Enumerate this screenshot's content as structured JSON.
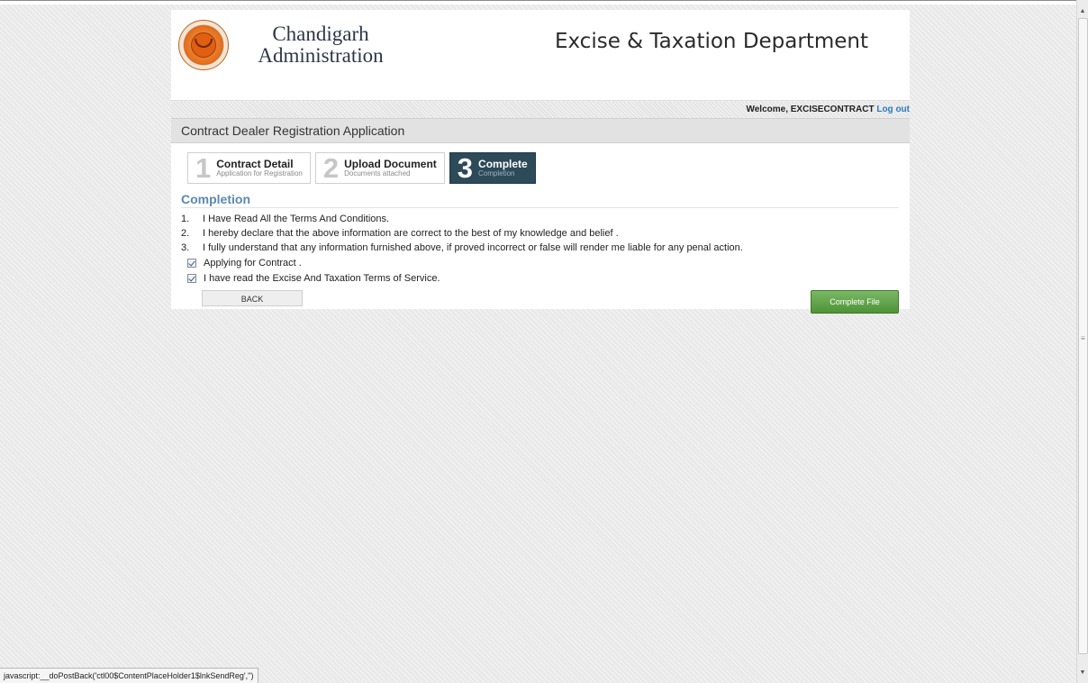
{
  "header": {
    "org_line1": "Chandigarh",
    "org_line2": "Administration",
    "department": "Excise & Taxation Department"
  },
  "welcome": {
    "prefix": "Welcome, ",
    "user": "EXCISECONTRACT",
    "logout": "Log out"
  },
  "page_title": "Contract Dealer Registration Application",
  "steps": [
    {
      "num": "1",
      "title": "Contract Detail",
      "subtitle": "Application for Registration",
      "active": false
    },
    {
      "num": "2",
      "title": "Upload Document",
      "subtitle": "Documents attached",
      "active": false
    },
    {
      "num": "3",
      "title": "Complete",
      "subtitle": "Completion",
      "active": true
    }
  ],
  "section_title": "Completion",
  "terms": [
    {
      "num": "1.",
      "text": "I Have Read All the Terms And Conditions."
    },
    {
      "num": "2.",
      "text": "I hereby declare that the above information are correct to the best of my knowledge and belief ."
    },
    {
      "num": "3.",
      "text": "I fully understand that any information furnished above, if proved incorrect or false will render me liable for any penal action."
    }
  ],
  "checkboxes": [
    {
      "label": "Applying for Contract .",
      "checked": true
    },
    {
      "label": "I have read the Excise And Taxation Terms of Service.",
      "checked": true
    }
  ],
  "buttons": {
    "back": "BACK",
    "complete": "Complete File"
  },
  "status_bar": "javascript:__doPostBack('ctl00$ContentPlaceHolder1$lnkSendReg','')",
  "colors": {
    "active_step": "#2c4a58",
    "section_title": "#5b88b3",
    "complete_button": "#5a9e40",
    "link": "#2e7bbd"
  }
}
